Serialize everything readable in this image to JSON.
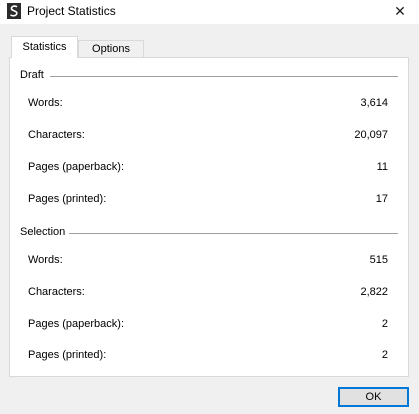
{
  "window": {
    "title": "Project Statistics",
    "close_glyph": "✕"
  },
  "tabs": [
    {
      "label": "Statistics",
      "active": true
    },
    {
      "label": "Options",
      "active": false
    }
  ],
  "draft": {
    "title": "Draft",
    "rows": [
      {
        "label": "Words:",
        "value": "3,614"
      },
      {
        "label": "Characters:",
        "value": "20,097"
      },
      {
        "label": "Pages (paperback):",
        "value": "11"
      },
      {
        "label": "Pages (printed):",
        "value": "17"
      }
    ]
  },
  "selection": {
    "title": "Selection",
    "rows": [
      {
        "label": "Words:",
        "value": "515"
      },
      {
        "label": "Characters:",
        "value": "2,822"
      },
      {
        "label": "Pages (paperback):",
        "value": "2"
      },
      {
        "label": "Pages (printed):",
        "value": "2"
      }
    ]
  },
  "buttons": {
    "ok_label": "OK"
  },
  "colors": {
    "accent": "#0078d7",
    "panel_bg": "#ffffff",
    "window_bg": "#f0f0f0"
  }
}
